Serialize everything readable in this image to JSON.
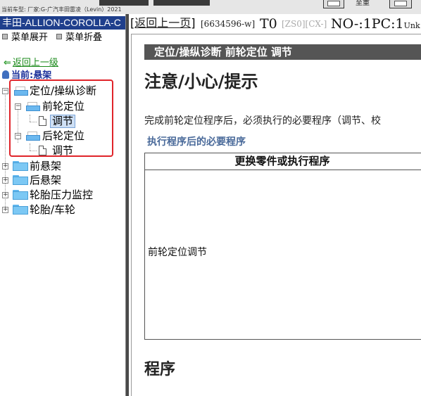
{
  "topbar": {
    "status_text": "当前车型:  厂家:G-广汽丰田雷凌（Levin）2021",
    "tool_label": "至重"
  },
  "sidebar": {
    "model": "丰田-ALLION-COROLLA-C",
    "expand_all": "菜单展开",
    "collapse_all": "菜单折叠",
    "back_up": "返回上一级",
    "current": "当前:悬架",
    "tree": {
      "alignment": "定位/操纵诊断",
      "front_alignment": "前轮定位",
      "front_adjust": "调节",
      "rear_alignment": "后轮定位",
      "rear_adjust": "调节",
      "front_suspension": "前悬架",
      "rear_suspension": "后悬架",
      "tpms": "轮胎压力监控",
      "tire_wheel": "轮胎/车轮"
    }
  },
  "doc": {
    "back_bracket_open": "[",
    "back_link": "返回上一页",
    "back_bracket_close": "]",
    "doc_id": "[6634596-w]",
    "t0": "T0",
    "zs": "[ZS0][CX-]",
    "no": "NO-:1PC:1",
    "no_tail": "Unk",
    "title": "定位/操纵诊断  前轮定位  调节",
    "notice": "注意/小心/提示",
    "notice_body": "完成前轮定位程序后，必须执行的必要程序（调节、校",
    "notice_sub": "执行程序后的必要程序",
    "table": {
      "header": "更换零件或执行程序",
      "cell": "前轮定位调节"
    },
    "program": "程序"
  }
}
